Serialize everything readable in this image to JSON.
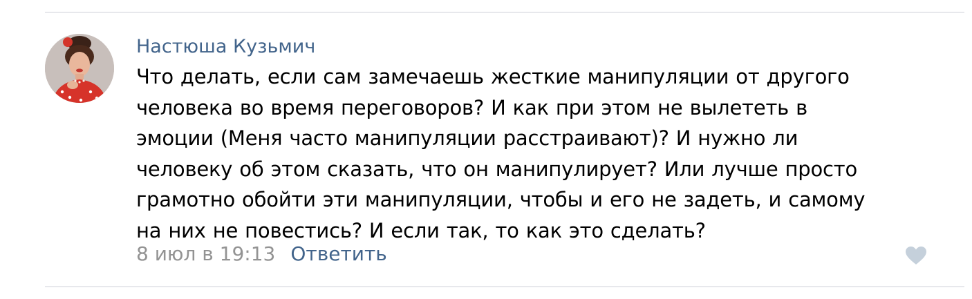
{
  "comment": {
    "author": "Настюша Кузьмич",
    "text_lines": [
      "Что делать, если сам замечаешь жесткие манипуляции от другого",
      "человека во время переговоров? И как при этом не вылететь в",
      "эмоции (Меня часто манипуляции расстраивают)? И нужно ли",
      "человеку об этом сказать, что он манипулирует? Или лучше просто",
      "грамотно обойти эти манипуляции, чтобы и его не задеть, и самому",
      "на них не повестись? И если так, то как это сделать?"
    ],
    "date": "8 июл в 19:13",
    "reply_label": "Ответить",
    "like_icon": "heart-icon"
  },
  "colors": {
    "link": "#42648b",
    "meta": "#939393",
    "divider": "#e7e8ec",
    "like": "#c5d0db"
  }
}
